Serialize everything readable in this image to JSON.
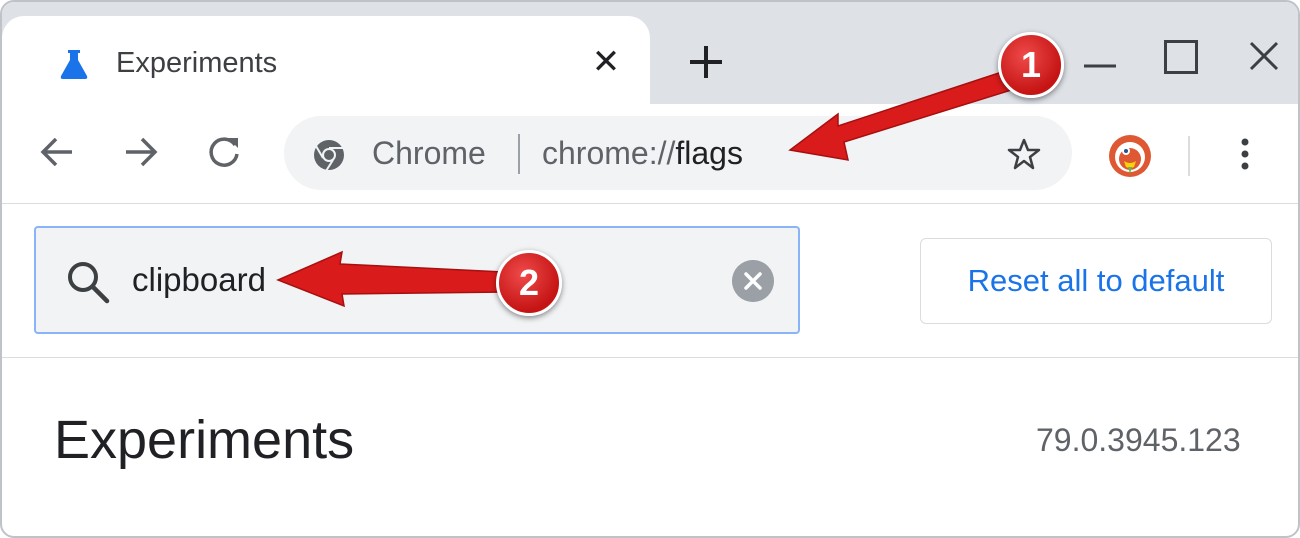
{
  "tab": {
    "title": "Experiments",
    "close_glyph": "✕"
  },
  "window": {
    "new_tab_icon": "plus-icon",
    "minimize_icon": "minimize-icon",
    "maximize_icon": "maximize-icon",
    "close_icon": "close-icon"
  },
  "omnibox": {
    "chip_label": "Chrome",
    "url_prefix": "chrome://",
    "url_host": "flags"
  },
  "search": {
    "value": "clipboard"
  },
  "reset_button_label": "Reset all to default",
  "page": {
    "title": "Experiments",
    "version": "79.0.3945.123"
  },
  "annotations": [
    {
      "number": "1"
    },
    {
      "number": "2"
    }
  ],
  "colors": {
    "accent": "#1a73e8",
    "annotation": "#d91b1b",
    "tab_strip": "#dee1e6"
  }
}
